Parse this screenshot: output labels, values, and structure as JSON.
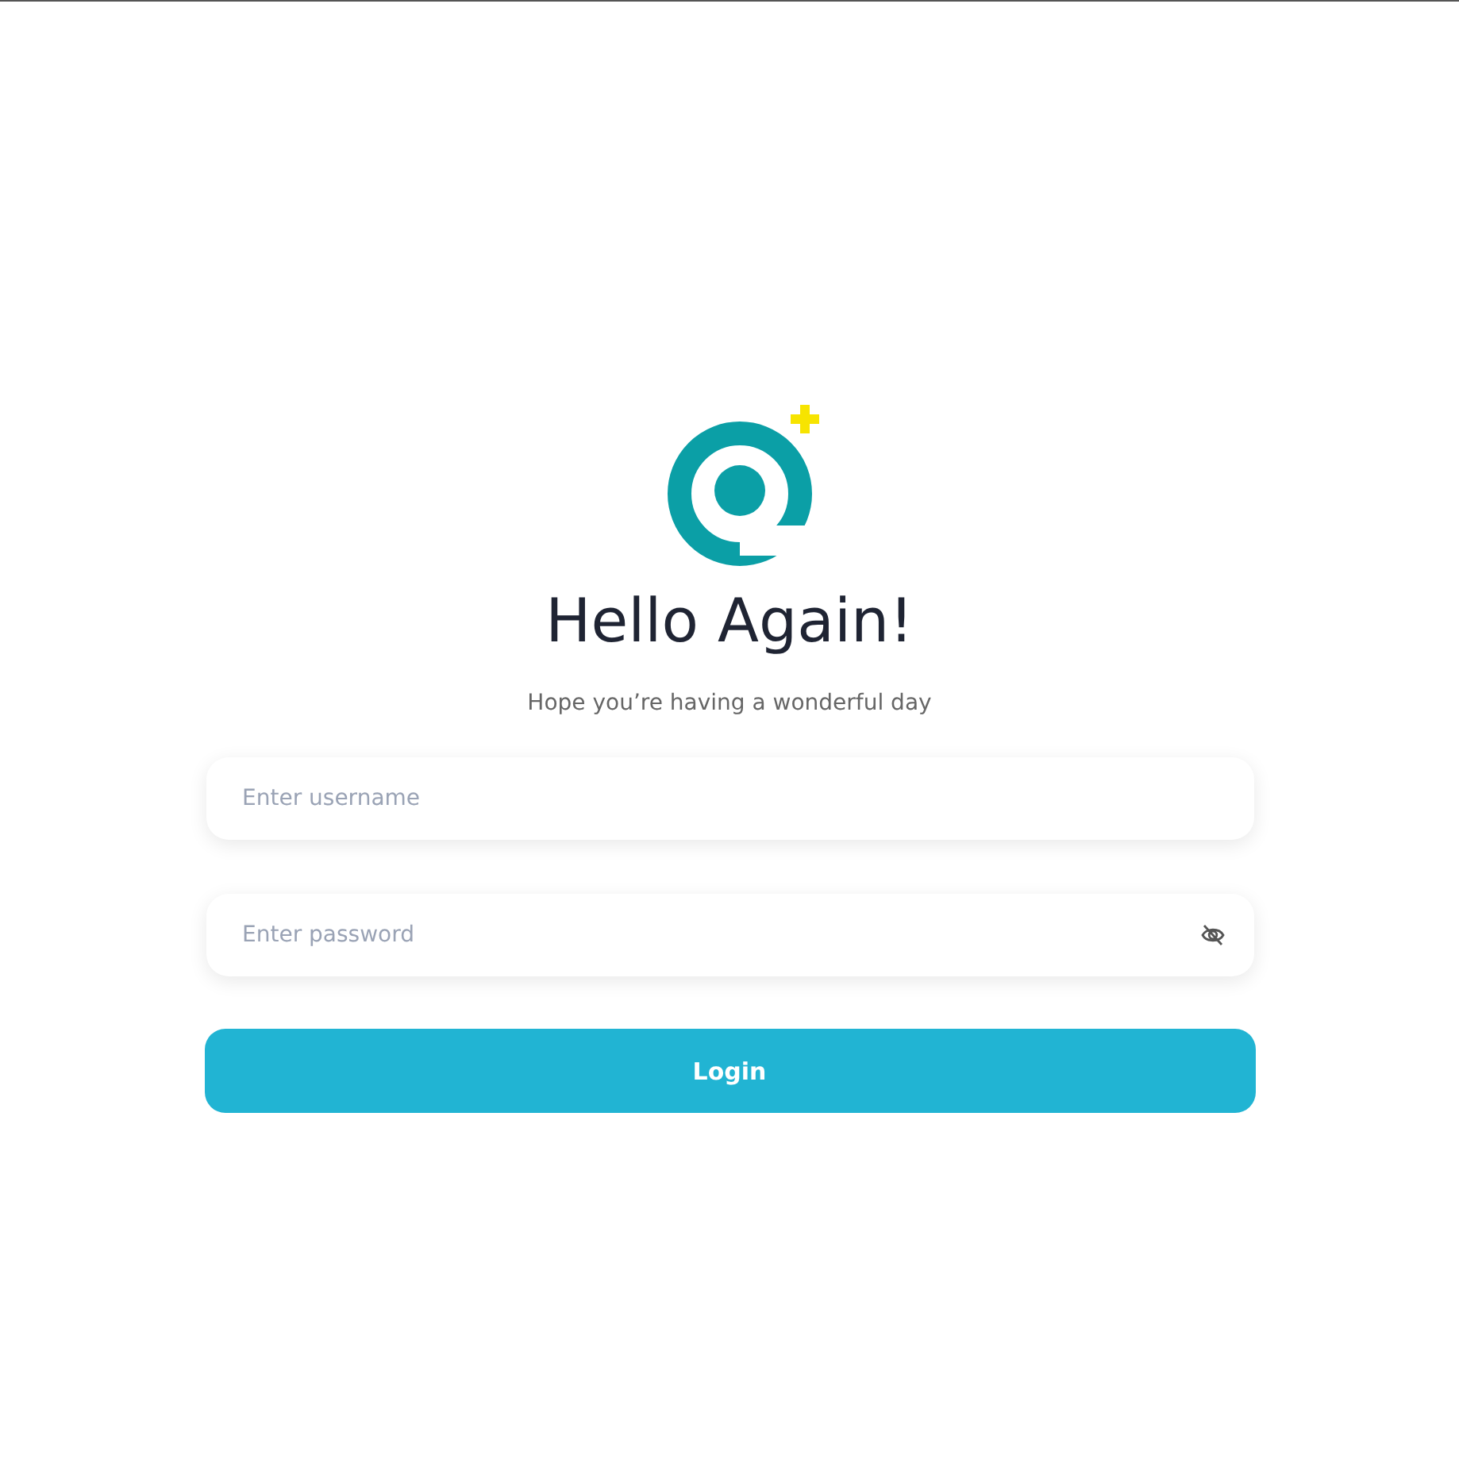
{
  "heading": "Hello Again!",
  "subtitle": "Hope you’re having a wonderful day",
  "fields": [
    {
      "placeholder": "Enter username",
      "kind": "text"
    },
    {
      "placeholder": "Enter password",
      "kind": "password"
    }
  ],
  "button": "Login"
}
